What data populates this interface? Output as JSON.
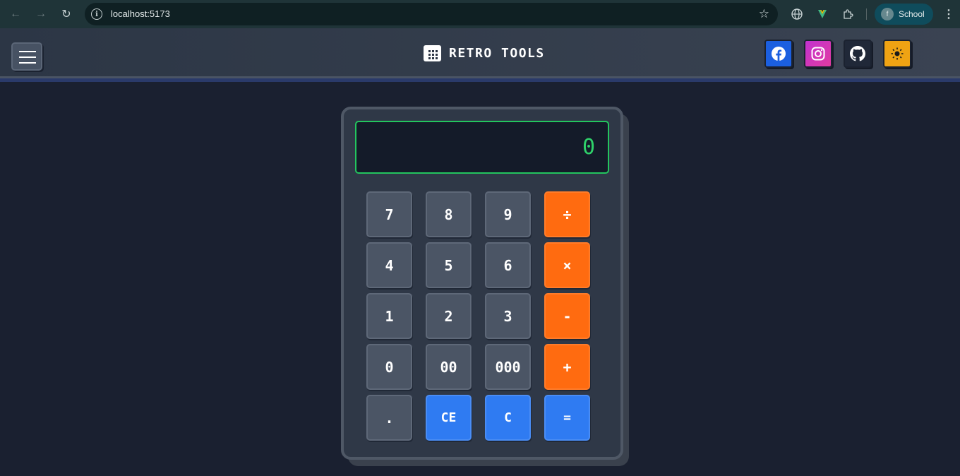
{
  "browser": {
    "url": "localhost:5173",
    "profile_initial": "f",
    "profile_name": "School"
  },
  "header": {
    "title": "RETRO TOOLS"
  },
  "calculator": {
    "display_value": "0",
    "keys": [
      {
        "label": "7",
        "kind": "num"
      },
      {
        "label": "8",
        "kind": "num"
      },
      {
        "label": "9",
        "kind": "num"
      },
      {
        "label": "÷",
        "kind": "op"
      },
      {
        "label": "4",
        "kind": "num"
      },
      {
        "label": "5",
        "kind": "num"
      },
      {
        "label": "6",
        "kind": "num"
      },
      {
        "label": "×",
        "kind": "op"
      },
      {
        "label": "1",
        "kind": "num"
      },
      {
        "label": "2",
        "kind": "num"
      },
      {
        "label": "3",
        "kind": "num"
      },
      {
        "label": "-",
        "kind": "op"
      },
      {
        "label": "0",
        "kind": "num"
      },
      {
        "label": "00",
        "kind": "num"
      },
      {
        "label": "000",
        "kind": "num"
      },
      {
        "label": "+",
        "kind": "op"
      },
      {
        "label": ".",
        "kind": "num"
      },
      {
        "label": "CE",
        "kind": "fn"
      },
      {
        "label": "C",
        "kind": "fn"
      },
      {
        "label": "=",
        "kind": "fn"
      }
    ]
  },
  "colors": {
    "display_text": "#2fd26a",
    "operator_key": "#ff6b10",
    "function_key": "#2f7bf2",
    "number_key": "#4b5565"
  }
}
